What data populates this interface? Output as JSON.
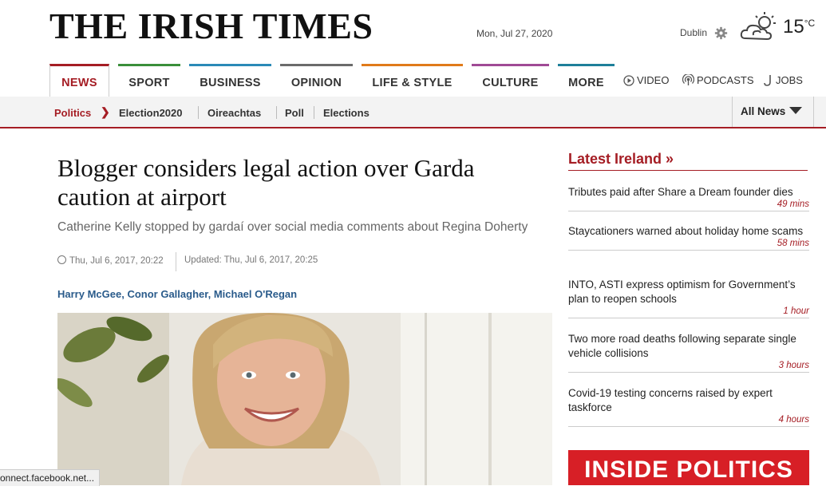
{
  "masthead": {
    "logo": "THE IRISH TIMES",
    "date": "Mon, Jul 27, 2020",
    "city": "Dublin",
    "temperature": "15",
    "temperature_unit": "°C",
    "weather_icon": "cloud-sun-icon",
    "settings_icon": "gear-icon"
  },
  "nav": {
    "items": [
      {
        "label": "NEWS",
        "color": "#a51d24"
      },
      {
        "label": "SPORT",
        "color": "#3a8f3a"
      },
      {
        "label": "BUSINESS",
        "color": "#2b8ab7"
      },
      {
        "label": "OPINION",
        "color": "#6b6b6b"
      },
      {
        "label": "LIFE & STYLE",
        "color": "#e07b1a"
      },
      {
        "label": "CULTURE",
        "color": "#a04a95"
      },
      {
        "label": "MORE",
        "color": "#1e7f9a"
      }
    ],
    "links": [
      {
        "label": "VIDEO",
        "icon": "play-icon"
      },
      {
        "label": "PODCASTS",
        "icon": "podcast-icon"
      },
      {
        "label": "JOBS",
        "icon": "jobs-icon"
      }
    ]
  },
  "subnav": {
    "section": "Politics",
    "items": [
      "Election2020",
      "Oireachtas",
      "Poll",
      "Elections"
    ],
    "all_news": "All News"
  },
  "article": {
    "headline": "Blogger considers legal action over Garda caution at airport",
    "standfirst": "Catherine Kelly stopped by gardaí over social media comments about Regina Doherty",
    "published": "Thu, Jul 6, 2017, 20:22",
    "updated": "Updated: Thu, Jul 6, 2017, 20:25",
    "authors": [
      "Harry McGee",
      "Conor Gallagher",
      "Michael O'Regan"
    ],
    "author_separator": ", "
  },
  "sidebar": {
    "title": "Latest Ireland »",
    "stories": [
      {
        "title": "Tributes paid after Share a Dream founder dies",
        "ago": "49 mins"
      },
      {
        "title": "Staycationers warned about holiday home scams",
        "ago": "58 mins"
      },
      {
        "title": "INTO, ASTI express optimism for Government’s plan to reopen schools",
        "ago": "1 hour"
      },
      {
        "title": "Two more road deaths following separate single vehicle collisions",
        "ago": "3 hours"
      },
      {
        "title": "Covid-19 testing concerns raised by expert taskforce",
        "ago": "4 hours"
      }
    ],
    "banner": "INSIDE POLITICS"
  },
  "status_bar": "onnect.facebook.net..."
}
